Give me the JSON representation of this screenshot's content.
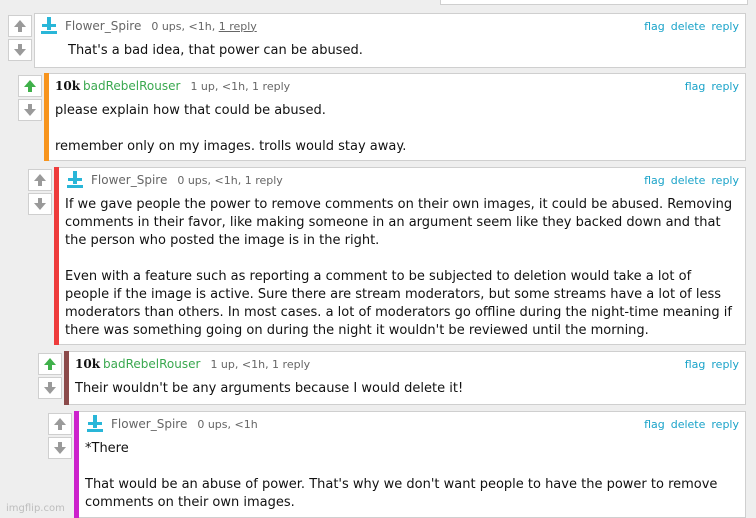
{
  "colors": {
    "link": "#1aa3c9",
    "green_user": "#3aa84f",
    "upvote_active": "#3fb04a"
  },
  "icons": {
    "upvote": "up-arrow-icon",
    "downvote": "down-arrow-icon",
    "avatar_flower": "pixel-figure-icon"
  },
  "comments": [
    {
      "username": "Flower_Spire",
      "badge": "",
      "meta_pre": "0 ups, <1h, ",
      "meta_link": "1 reply",
      "actions": [
        "flag",
        "delete",
        "reply"
      ],
      "text": "That's a bad idea, that power can be abused.",
      "bar_color": "",
      "upvoted": false
    },
    {
      "username": "badRebelRouser",
      "badge": "10k",
      "meta_pre": "1 up, <1h, 1 reply",
      "meta_link": "",
      "actions": [
        "flag",
        "reply"
      ],
      "text": "please explain how that could be abused.\n\nremember only on my images. trolls would stay away.",
      "bar_color": "#f7941d",
      "upvoted": true
    },
    {
      "username": "Flower_Spire",
      "badge": "",
      "meta_pre": "0 ups, <1h, 1 reply",
      "meta_link": "",
      "actions": [
        "flag",
        "delete",
        "reply"
      ],
      "text": "If we gave people the power to remove comments on their own images, it could be abused. Removing comments in their favor, like making someone in an argument seem like they backed down and that the person who posted the image is in the right.\n\nEven with a feature such as reporting a comment to be subjected to deletion would take a lot of people if the image is active. Sure there are stream moderators, but some streams have a lot of less moderators than others. In most cases. a lot of moderators go offline during the night-time meaning if there was something going on during the night it wouldn't be reviewed until the morning.",
      "bar_color": "#ee3b3b",
      "upvoted": false
    },
    {
      "username": "badRebelRouser",
      "badge": "10k",
      "meta_pre": "1 up, <1h, 1 reply",
      "meta_link": "",
      "actions": [
        "flag",
        "reply"
      ],
      "text": "Their wouldn't be any arguments because I would delete it!",
      "bar_color": "#8b4a4a",
      "upvoted": true
    },
    {
      "username": "Flower_Spire",
      "badge": "",
      "meta_pre": "0 ups, <1h",
      "meta_link": "",
      "actions": [
        "flag",
        "delete",
        "reply"
      ],
      "text": "*There\n\nThat would be an abuse of power. That's why we don't want people to have the power to remove comments on their own images.",
      "bar_color": "#cc22cc",
      "upvoted": false
    }
  ],
  "watermark": "imgflip.com"
}
